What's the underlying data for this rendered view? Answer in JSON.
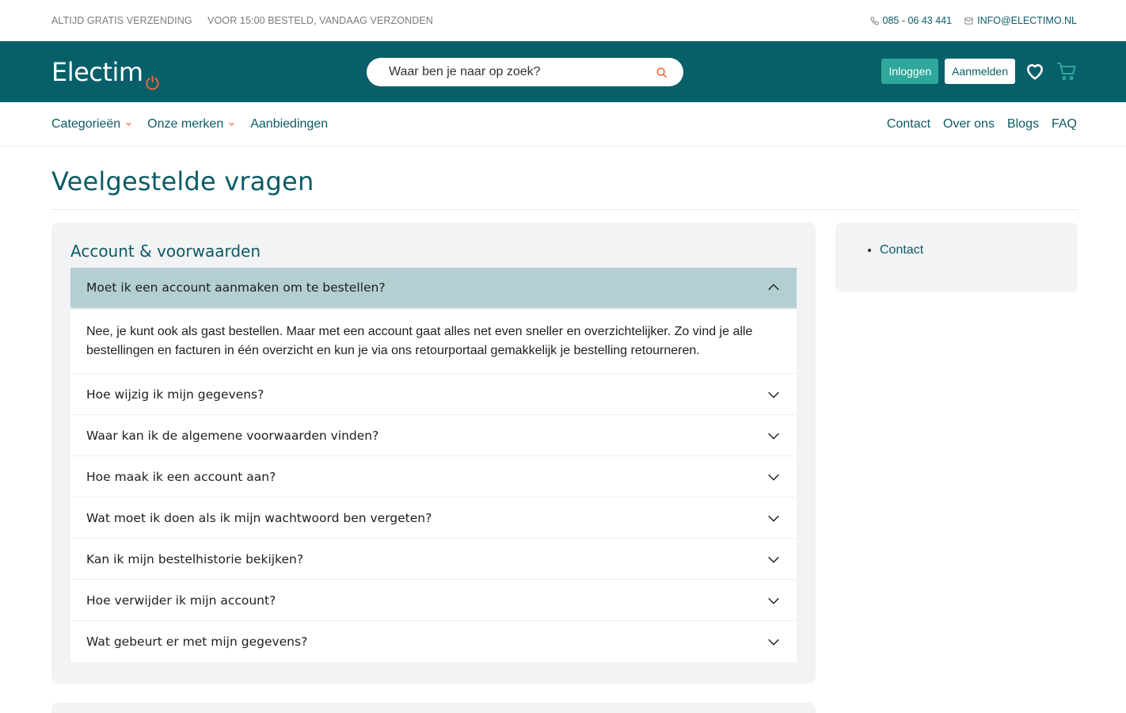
{
  "topbar": {
    "usp1": "ALTIJD GRATIS VERZENDING",
    "usp2": "VOOR 15:00 BESTELD, VANDAAG VERZONDEN",
    "phone": "085 - 06 43 441",
    "email": "INFO@ELECTIMO.NL"
  },
  "header": {
    "logo_text": "Electim",
    "search_placeholder": "Waar ben je naar op zoek?",
    "login_label": "Inloggen",
    "register_label": "Aanmelden"
  },
  "nav": {
    "left": [
      "Categorieën",
      "Onze merken",
      "Aanbiedingen"
    ],
    "right": [
      "Contact",
      "Over ons",
      "Blogs",
      "FAQ"
    ]
  },
  "page": {
    "title": "Veelgestelde vragen"
  },
  "faq": {
    "section_title": "Account & voorwaarden",
    "items": [
      {
        "question": "Moet ik een account aanmaken om te bestellen?",
        "answer": "Nee, je kunt ook als gast bestellen. Maar met een account gaat alles net even sneller en overzichtelijker. Zo vind je alle bestellingen en facturen in één overzicht en kun je via ons retourportaal gemakkelijk je bestelling retourneren.",
        "open": true
      },
      {
        "question": "Hoe wijzig ik mijn gegevens?"
      },
      {
        "question": "Waar kan ik de algemene voorwaarden vinden?"
      },
      {
        "question": "Hoe maak ik een account aan?"
      },
      {
        "question": "Wat moet ik doen als ik mijn wachtwoord ben vergeten?"
      },
      {
        "question": "Kan ik mijn bestelhistorie bekijken?"
      },
      {
        "question": "Hoe verwijder ik mijn account?"
      },
      {
        "question": "Wat gebeurt er met mijn gegevens?"
      }
    ]
  },
  "sidebar": {
    "links": [
      "Contact"
    ]
  },
  "colors": {
    "brand": "#075f69",
    "accent": "#2ea89a",
    "logo_dot": "#f26a3d",
    "open_row": "#b3cfd2"
  },
  "icons": {
    "phone": "phone-icon",
    "mail": "mail-icon",
    "search": "search-icon",
    "heart": "heart-icon",
    "cart": "cart-icon",
    "chevron_down": "chevron-down-icon",
    "chevron_up": "chevron-up-icon"
  }
}
